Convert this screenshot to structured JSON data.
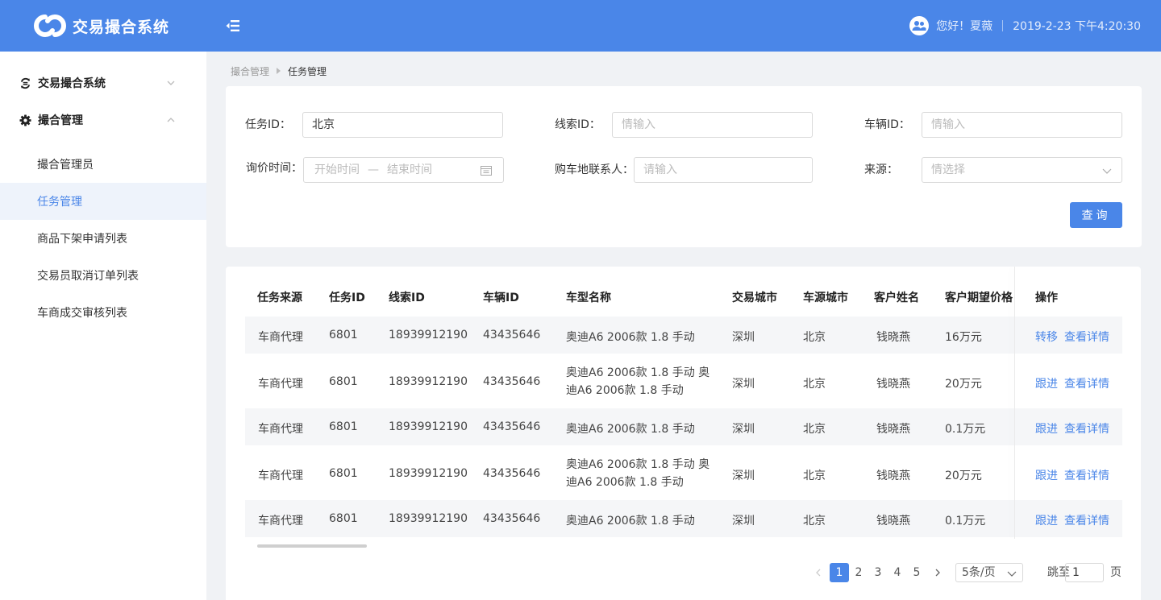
{
  "app": {
    "title": "交易撮合系统",
    "greeting": "您好！夏薇",
    "datetime": "2019-2-23 下午4:20:30",
    "brand_color": "#4a86e8"
  },
  "sidebar": {
    "groups": [
      {
        "label": "交易撮合系统",
        "icon": "exchange-icon",
        "expanded": false
      },
      {
        "label": "撮合管理",
        "icon": "gear-icon",
        "expanded": true
      }
    ],
    "items": [
      {
        "label": "撮合管理员",
        "active": false
      },
      {
        "label": "任务管理",
        "active": true
      },
      {
        "label": "商品下架申请列表",
        "active": false
      },
      {
        "label": "交易员取消订单列表",
        "active": false
      },
      {
        "label": "车商成交审核列表",
        "active": false
      }
    ]
  },
  "breadcrumb": [
    "撮合管理",
    "任务管理"
  ],
  "filters": {
    "task_id": {
      "label": "任务ID：",
      "value": "北京"
    },
    "lead_id": {
      "label": "线索ID：",
      "placeholder": "情输入"
    },
    "vehicle_id": {
      "label": "车辆ID：",
      "placeholder": "情输入"
    },
    "inquiry_time": {
      "label": "询价时间：",
      "start_placeholder": "开始时间",
      "separator": "—",
      "end_placeholder": "结束时间"
    },
    "contact": {
      "label": "购车地联系人：",
      "placeholder": "请输入"
    },
    "source": {
      "label": "来源：",
      "placeholder": "情选择"
    },
    "query_button": "查询"
  },
  "table": {
    "columns": [
      "任务来源",
      "任务ID",
      "线索ID",
      "车辆ID",
      "车型名称",
      "交易城市",
      "车源城市",
      "客户姓名",
      "客户期望价格",
      "操作"
    ],
    "rows": [
      {
        "source": "车商代理",
        "task_id": "6801",
        "lead_id": "18939912190",
        "vehicle_id": "43435646",
        "model": "奥迪A6 2006款 1.8 手动",
        "trade_city": "深圳",
        "origin_city": "北京",
        "customer": "钱晓燕",
        "price": "16万元",
        "action1": "转移",
        "action2": "查看详情"
      },
      {
        "source": "车商代理",
        "task_id": "6801",
        "lead_id": "18939912190",
        "vehicle_id": "43435646",
        "model": "奥迪A6 2006款 1.8 手动 奥迪A6 2006款 1.8 手动",
        "trade_city": "深圳",
        "origin_city": "北京",
        "customer": "钱晓燕",
        "price": "20万元",
        "action1": "跟进",
        "action2": "查看详情"
      },
      {
        "source": "车商代理",
        "task_id": "6801",
        "lead_id": "18939912190",
        "vehicle_id": "43435646",
        "model": "奥迪A6 2006款 1.8 手动",
        "trade_city": "深圳",
        "origin_city": "北京",
        "customer": "钱晓燕",
        "price": "0.1万元",
        "action1": "跟进",
        "action2": "查看详情"
      },
      {
        "source": "车商代理",
        "task_id": "6801",
        "lead_id": "18939912190",
        "vehicle_id": "43435646",
        "model": "奥迪A6 2006款 1.8 手动 奥迪A6 2006款 1.8 手动",
        "trade_city": "深圳",
        "origin_city": "北京",
        "customer": "钱晓燕",
        "price": "20万元",
        "action1": "跟进",
        "action2": "查看详情"
      },
      {
        "source": "车商代理",
        "task_id": "6801",
        "lead_id": "18939912190",
        "vehicle_id": "43435646",
        "model": "奥迪A6 2006款 1.8 手动",
        "trade_city": "深圳",
        "origin_city": "北京",
        "customer": "钱晓燕",
        "price": "0.1万元",
        "action1": "跟进",
        "action2": "查看详情"
      }
    ]
  },
  "pagination": {
    "pages": [
      "1",
      "2",
      "3",
      "4",
      "5"
    ],
    "current": "1",
    "page_size": "5条/页",
    "jump_label": "跳至",
    "jump_value": "1",
    "page_suffix": "页"
  }
}
